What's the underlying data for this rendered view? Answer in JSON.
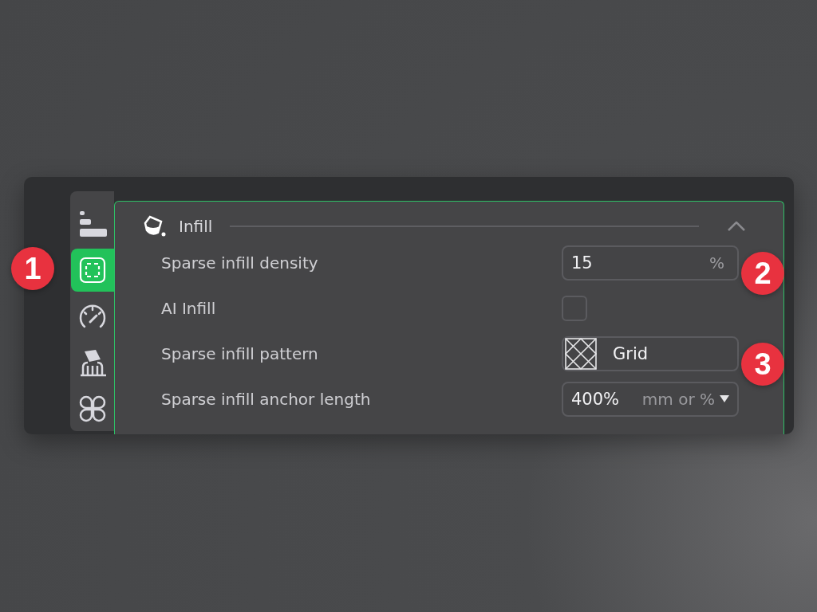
{
  "sidebar": {
    "items": [
      {
        "kind": "quality",
        "selected": false
      },
      {
        "kind": "strength",
        "selected": true
      },
      {
        "kind": "speed",
        "selected": false
      },
      {
        "kind": "support",
        "selected": false
      },
      {
        "kind": "others",
        "selected": false
      }
    ]
  },
  "section": {
    "title": "Infill",
    "expanded": true,
    "rows": [
      {
        "kind": "number",
        "label": "Sparse infill density",
        "value": "15",
        "unit": "%"
      },
      {
        "kind": "checkbox",
        "label": "AI Infill",
        "checked": false
      },
      {
        "kind": "select",
        "label": "Sparse infill pattern",
        "value": "Grid"
      },
      {
        "kind": "combo",
        "label": "Sparse infill anchor length",
        "value": "400%",
        "unit": "mm or %"
      }
    ]
  },
  "callouts": [
    "1",
    "2",
    "3"
  ]
}
